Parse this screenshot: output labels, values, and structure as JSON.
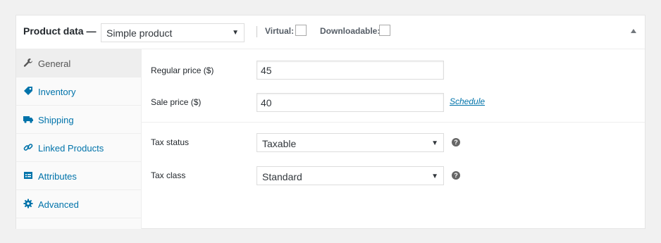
{
  "header": {
    "title": "Product data —",
    "product_type": "Simple product",
    "virtual_label": "Virtual:",
    "downloadable_label": "Downloadable:"
  },
  "tabs": [
    {
      "label": "General",
      "icon": "wrench-icon",
      "active": true
    },
    {
      "label": "Inventory",
      "icon": "tag-icon",
      "active": false
    },
    {
      "label": "Shipping",
      "icon": "truck-icon",
      "active": false
    },
    {
      "label": "Linked Products",
      "icon": "link-icon",
      "active": false
    },
    {
      "label": "Attributes",
      "icon": "list-icon",
      "active": false
    },
    {
      "label": "Advanced",
      "icon": "gear-icon",
      "active": false
    }
  ],
  "general": {
    "regular_price_label": "Regular price ($)",
    "regular_price": "45",
    "sale_price_label": "Sale price ($)",
    "sale_price": "40",
    "schedule_link": "Schedule",
    "tax_status_label": "Tax status",
    "tax_status": "Taxable",
    "tax_class_label": "Tax class",
    "tax_class": "Standard"
  },
  "colors": {
    "link": "#0073aa",
    "active_tab_bg": "#eeeeee",
    "page_bg": "#f1f1f1"
  }
}
